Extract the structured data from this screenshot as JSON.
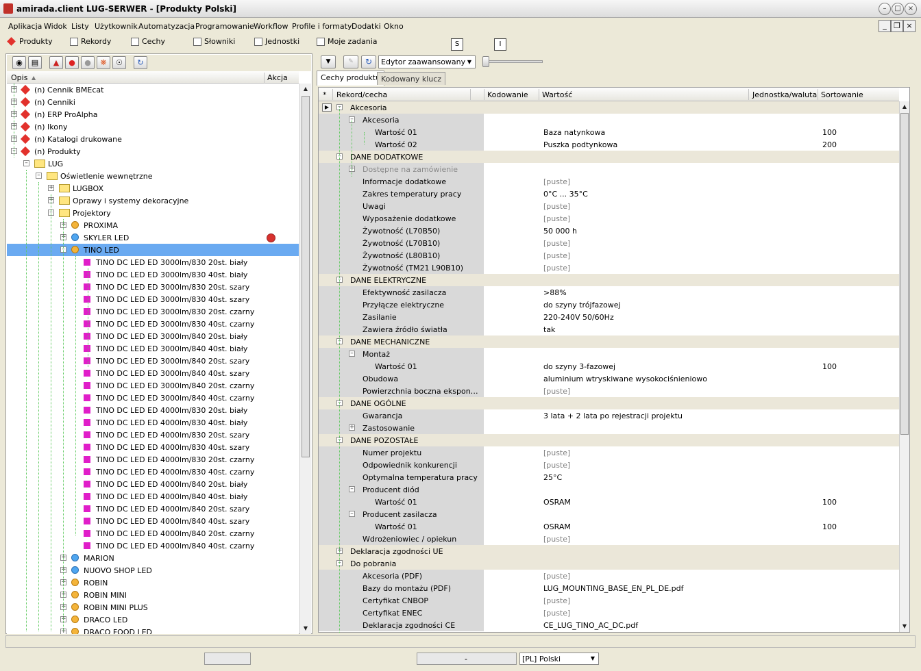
{
  "window": {
    "title": "amirada.client LUG-SERWER - [Produkty Polski]"
  },
  "menu": [
    "Aplikacja",
    "Widok",
    "Listy",
    "Użytkownik",
    "Automatyzacja",
    "Programowanie",
    "Workflow",
    "Profile i formaty",
    "Dodatki",
    "Okno"
  ],
  "toolbar": {
    "items": [
      {
        "label": "Produkty",
        "icon": "diamond-icon"
      },
      {
        "label": "Rekordy",
        "icon": "records-icon"
      },
      {
        "label": "Cechy",
        "icon": "features-icon"
      },
      {
        "label": "Słowniki",
        "icon": "dictionary-icon"
      },
      {
        "label": "Jednostki",
        "icon": "units-icon"
      },
      {
        "label": "Moje zadania",
        "icon": "tasks-icon"
      }
    ],
    "letter_s": "S",
    "letter_i": "I"
  },
  "tree": {
    "headers": {
      "desc": "Opis",
      "action": "Akcja"
    },
    "rows": [
      {
        "label": "(n) Cennik BMEcat",
        "level": 0,
        "icon": "diamond",
        "exp": "+"
      },
      {
        "label": "(n) Cenniki",
        "level": 0,
        "icon": "diamond",
        "exp": "+"
      },
      {
        "label": "(n) ERP ProAlpha",
        "level": 0,
        "icon": "diamond",
        "exp": "+"
      },
      {
        "label": "(n) Ikony",
        "level": 0,
        "icon": "diamond",
        "exp": "+"
      },
      {
        "label": "(n) Katalogi drukowane",
        "level": 0,
        "icon": "diamond",
        "exp": "+"
      },
      {
        "label": "(n) Produkty",
        "level": 0,
        "icon": "diamond",
        "exp": "-"
      },
      {
        "label": "LUG",
        "level": 1,
        "icon": "folder",
        "exp": "-"
      },
      {
        "label": "Oświetlenie wewnętrzne",
        "level": 2,
        "icon": "folder",
        "exp": "-"
      },
      {
        "label": "LUGBOX",
        "level": 3,
        "icon": "folder",
        "exp": "+"
      },
      {
        "label": "Oprawy i systemy dekoracyjne",
        "level": 3,
        "icon": "folder",
        "exp": "+"
      },
      {
        "label": "Projektory",
        "level": 3,
        "icon": "folder",
        "exp": "-"
      },
      {
        "label": "PROXIMA",
        "level": 4,
        "icon": "bulb",
        "exp": "+"
      },
      {
        "label": "SKYLER LED",
        "level": 4,
        "icon": "bulb-blue",
        "exp": "+"
      },
      {
        "label": "TINO LED",
        "level": 4,
        "icon": "bulb",
        "exp": "-",
        "selected": true
      },
      {
        "label": "TINO DC LED ED 3000lm/830 20st. biały",
        "level": 5,
        "icon": "prod"
      },
      {
        "label": "TINO DC LED ED 3000lm/830 40st. biały",
        "level": 5,
        "icon": "prod"
      },
      {
        "label": "TINO DC LED ED 3000lm/830 20st. szary",
        "level": 5,
        "icon": "prod"
      },
      {
        "label": "TINO DC LED ED 3000lm/830 40st. szary",
        "level": 5,
        "icon": "prod"
      },
      {
        "label": "TINO DC LED ED 3000lm/830 20st. czarny",
        "level": 5,
        "icon": "prod"
      },
      {
        "label": "TINO DC LED ED 3000lm/830 40st. czarny",
        "level": 5,
        "icon": "prod"
      },
      {
        "label": "TINO DC LED ED 3000lm/840 20st. biały",
        "level": 5,
        "icon": "prod"
      },
      {
        "label": "TINO DC LED ED 3000lm/840 40st. biały",
        "level": 5,
        "icon": "prod"
      },
      {
        "label": "TINO DC LED ED 3000lm/840 20st. szary",
        "level": 5,
        "icon": "prod"
      },
      {
        "label": "TINO DC LED ED 3000lm/840 40st. szary",
        "level": 5,
        "icon": "prod"
      },
      {
        "label": "TINO DC LED ED 3000lm/840 20st. czarny",
        "level": 5,
        "icon": "prod"
      },
      {
        "label": "TINO DC LED ED 3000lm/840 40st. czarny",
        "level": 5,
        "icon": "prod"
      },
      {
        "label": "TINO DC LED ED 4000lm/830 20st. biały",
        "level": 5,
        "icon": "prod"
      },
      {
        "label": "TINO DC LED ED 4000lm/830 40st. biały",
        "level": 5,
        "icon": "prod"
      },
      {
        "label": "TINO DC LED ED 4000lm/830 20st. szary",
        "level": 5,
        "icon": "prod"
      },
      {
        "label": "TINO DC LED ED 4000lm/830 40st. szary",
        "level": 5,
        "icon": "prod"
      },
      {
        "label": "TINO DC LED ED 4000lm/830 20st. czarny",
        "level": 5,
        "icon": "prod"
      },
      {
        "label": "TINO DC LED ED 4000lm/830 40st. czarny",
        "level": 5,
        "icon": "prod"
      },
      {
        "label": "TINO DC LED ED 4000lm/840 20st. biały",
        "level": 5,
        "icon": "prod"
      },
      {
        "label": "TINO DC LED ED 4000lm/840 40st. biały",
        "level": 5,
        "icon": "prod"
      },
      {
        "label": "TINO DC LED ED 4000lm/840 20st. szary",
        "level": 5,
        "icon": "prod"
      },
      {
        "label": "TINO DC LED ED 4000lm/840 40st. szary",
        "level": 5,
        "icon": "prod"
      },
      {
        "label": "TINO DC LED ED 4000lm/840 20st. czarny",
        "level": 5,
        "icon": "prod"
      },
      {
        "label": "TINO DC LED ED 4000lm/840 40st. czarny",
        "level": 5,
        "icon": "prod"
      },
      {
        "label": "MARION",
        "level": 4,
        "icon": "bulb-blue",
        "exp": "+"
      },
      {
        "label": "NUOVO SHOP LED",
        "level": 4,
        "icon": "bulb-blue",
        "exp": "+"
      },
      {
        "label": "ROBIN",
        "level": 4,
        "icon": "bulb",
        "exp": "+"
      },
      {
        "label": "ROBIN MINI",
        "level": 4,
        "icon": "bulb",
        "exp": "+"
      },
      {
        "label": "ROBIN MINI PLUS",
        "level": 4,
        "icon": "bulb",
        "exp": "+"
      },
      {
        "label": "DRACO LED",
        "level": 4,
        "icon": "bulb",
        "exp": "+"
      },
      {
        "label": "DRACO FOOD LED",
        "level": 4,
        "icon": "bulb",
        "exp": "+"
      }
    ]
  },
  "editor": {
    "mode": "Edytor zaawansowany"
  },
  "tabs": [
    "Cechy produktu",
    "Kodowany klucz"
  ],
  "grid": {
    "headers": {
      "star": "*",
      "record": "Rekord/cecha",
      "coding": "Kodowanie",
      "value": "Wartość",
      "unit": "Jednostka/waluta",
      "sort": "Sortowanie"
    },
    "rows": [
      {
        "label": "Akcesoria",
        "level": 0,
        "group": true,
        "exp": "-"
      },
      {
        "label": "Akcesoria",
        "level": 1,
        "exp": "-"
      },
      {
        "label": "Wartość 01",
        "level": 2,
        "value": "Baza natynkowa",
        "sort": "100"
      },
      {
        "label": "Wartość 02",
        "level": 2,
        "value": "Puszka podtynkowa",
        "sort": "200"
      },
      {
        "label": "DANE DODATKOWE",
        "level": 0,
        "group": true,
        "exp": "-"
      },
      {
        "label": "Dostępne na zamówienie",
        "level": 1,
        "exp": "+",
        "dim": true
      },
      {
        "label": "Informacje dodatkowe",
        "level": 1,
        "value": "[puste]",
        "empty": true
      },
      {
        "label": "Zakres temperatury pracy",
        "level": 1,
        "value": "0°C ... 35°C"
      },
      {
        "label": "Uwagi",
        "level": 1,
        "value": "[puste]",
        "empty": true
      },
      {
        "label": "Wyposażenie dodatkowe",
        "level": 1,
        "value": "[puste]",
        "empty": true
      },
      {
        "label": "Żywotność (L70B50)",
        "level": 1,
        "value": "50 000 h"
      },
      {
        "label": "Żywotność (L70B10)",
        "level": 1,
        "value": "[puste]",
        "empty": true
      },
      {
        "label": "Żywotność (L80B10)",
        "level": 1,
        "value": "[puste]",
        "empty": true
      },
      {
        "label": "Żywotność (TM21 L90B10)",
        "level": 1,
        "value": "[puste]",
        "empty": true
      },
      {
        "label": "DANE ELEKTRYCZNE",
        "level": 0,
        "group": true,
        "exp": "-"
      },
      {
        "label": "Efektywność zasilacza",
        "level": 1,
        "value": ">88%"
      },
      {
        "label": "Przyłącze elektryczne",
        "level": 1,
        "value": "do szyny trójfazowej"
      },
      {
        "label": "Zasilanie",
        "level": 1,
        "value": "220-240V 50/60Hz"
      },
      {
        "label": "Zawiera źródło światła",
        "level": 1,
        "value": "tak"
      },
      {
        "label": "DANE MECHANICZNE",
        "level": 0,
        "group": true,
        "exp": "-"
      },
      {
        "label": "Montaż",
        "level": 1,
        "exp": "-"
      },
      {
        "label": "Wartość 01",
        "level": 2,
        "value": "do szyny 3-fazowej",
        "sort": "100"
      },
      {
        "label": "Obudowa",
        "level": 1,
        "value": "aluminium wtryskiwane wysokociśnieniowo"
      },
      {
        "label": "Powierzchnia boczna ekspon…",
        "level": 1,
        "value": "[puste]",
        "empty": true
      },
      {
        "label": "DANE OGÓLNE",
        "level": 0,
        "group": true,
        "exp": "-"
      },
      {
        "label": "Gwarancja",
        "level": 1,
        "value": "3 lata + 2 lata po rejestracji projektu"
      },
      {
        "label": "Zastosowanie",
        "level": 1,
        "exp": "+"
      },
      {
        "label": "DANE POZOSTAŁE",
        "level": 0,
        "group": true,
        "exp": "-"
      },
      {
        "label": "Numer projektu",
        "level": 1,
        "value": "[puste]",
        "empty": true
      },
      {
        "label": "Odpowiednik konkurencji",
        "level": 1,
        "value": "[puste]",
        "empty": true
      },
      {
        "label": "Optymalna temperatura pracy",
        "level": 1,
        "value": "25°C"
      },
      {
        "label": "Producent diód",
        "level": 1,
        "exp": "-"
      },
      {
        "label": "Wartość 01",
        "level": 2,
        "value": "OSRAM",
        "sort": "100"
      },
      {
        "label": "Producent zasilacza",
        "level": 1,
        "exp": "-"
      },
      {
        "label": "Wartość 01",
        "level": 2,
        "value": "OSRAM",
        "sort": "100"
      },
      {
        "label": "Wdrożeniowiec / opiekun",
        "level": 1,
        "value": "[puste]",
        "empty": true
      },
      {
        "label": "Deklaracja zgodności UE",
        "level": 0,
        "group": true,
        "exp": "+"
      },
      {
        "label": "Do pobrania",
        "level": 0,
        "group": true,
        "exp": "-"
      },
      {
        "label": "Akcesoria (PDF)",
        "level": 1,
        "value": "[puste]",
        "empty": true
      },
      {
        "label": "Bazy do montażu (PDF)",
        "level": 1,
        "value": "LUG_MOUNTING_BASE_EN_PL_DE.pdf"
      },
      {
        "label": "Certyfikat CNBOP",
        "level": 1,
        "value": "[puste]",
        "empty": true
      },
      {
        "label": "Certyfikat ENEC",
        "level": 1,
        "value": "[puste]",
        "empty": true
      },
      {
        "label": "Deklaracja zgodności CE",
        "level": 1,
        "value": "CE_LUG_TINO_AC_DC.pdf"
      }
    ]
  },
  "status": {
    "dash": "-",
    "language": "[PL] Polski"
  },
  "colors": {
    "selection": "#6aaaf1",
    "group_row": "#ebe7d9",
    "label_col": "#d9d9d9"
  }
}
